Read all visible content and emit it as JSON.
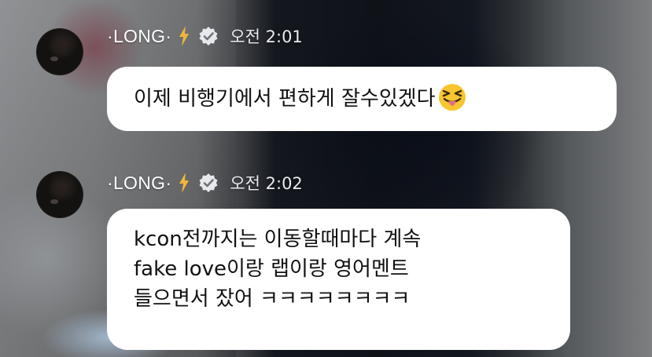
{
  "messages": [
    {
      "author": "·LONG·",
      "time": "오전 2:01",
      "text": "이제 비행기에서 편하게 잘수있겠다",
      "emoji_icon": "squinting-face-with-tongue-icon"
    },
    {
      "author": "·LONG·",
      "time": "오전 2:02",
      "lines": [
        "kcon전까지는 이동할때마다 계속",
        "fake love이랑 랩이랑 영어멘트",
        "들으면서 잤어 ㅋㅋㅋㅋㅋㅋㅋㅋ"
      ]
    }
  ],
  "icons": {
    "badge": "lightning-bolt-icon",
    "verified": "verified-check-icon"
  },
  "colors": {
    "bubble": "#ffffff",
    "bolt": "#f2b53a",
    "verified": "#e6e9ec",
    "emoji_face": "#f8c530",
    "emoji_tongue": "#e86a8a"
  }
}
